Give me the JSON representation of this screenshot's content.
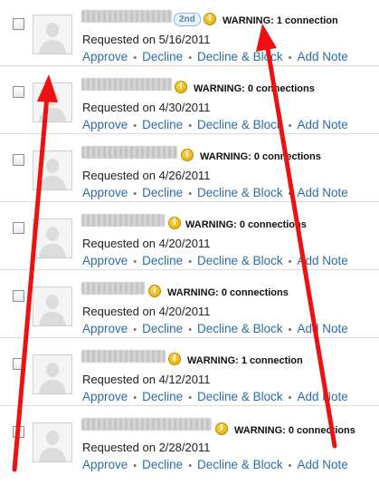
{
  "requests": [
    {
      "degree": "2nd",
      "warning": "WARNING: 1 connection",
      "requested": "Requested on 5/16/2011"
    },
    {
      "degree": "",
      "warning": "WARNING: 0 connections",
      "requested": "Requested on 4/30/2011"
    },
    {
      "degree": "",
      "warning": "WARNING: 0 connections",
      "requested": "Requested on 4/26/2011"
    },
    {
      "degree": "",
      "warning": "WARNING: 0 connections",
      "requested": "Requested on 4/20/2011"
    },
    {
      "degree": "",
      "warning": "WARNING: 0 connections",
      "requested": "Requested on 4/20/2011"
    },
    {
      "degree": "",
      "warning": "WARNING: 1 connection",
      "requested": "Requested on 4/12/2011"
    },
    {
      "degree": "",
      "warning": "WARNING: 0 connections",
      "requested": "Requested on 2/28/2011"
    }
  ],
  "actions": {
    "approve": "Approve",
    "decline": "Decline",
    "decline_block": "Decline & Block",
    "add_note": "Add Note",
    "separator": "•"
  },
  "icons": {
    "warning": "warning-info-icon",
    "avatar": "default-avatar-icon",
    "checkbox": "checkbox"
  },
  "colors": {
    "link": "#2b6ca8",
    "annotation_arrow": "#ee1111"
  }
}
